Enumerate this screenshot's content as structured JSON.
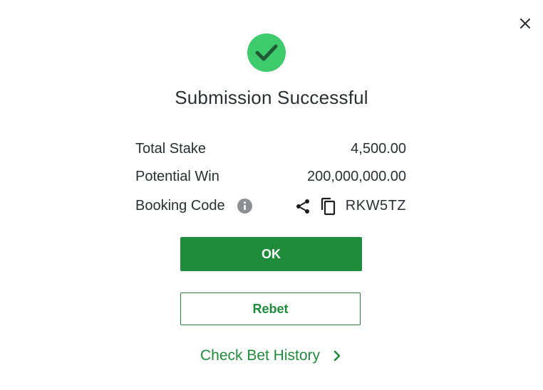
{
  "dialog": {
    "close_icon": "close-icon",
    "success_icon": "checkmark-icon",
    "title": "Submission Successful"
  },
  "summary": {
    "total_stake_label": "Total Stake",
    "total_stake_value": "4,500.00",
    "potential_win_label": "Potential Win",
    "potential_win_value": "200,000,000.00",
    "booking_code_label": "Booking Code",
    "booking_code_value": "RKW5TZ",
    "info_icon": "info-icon",
    "share_icon": "share-icon",
    "copy_icon": "copy-icon"
  },
  "actions": {
    "ok_label": "OK",
    "rebet_label": "Rebet",
    "history_label": "Check Bet History",
    "history_icon": "chevron-right-icon"
  },
  "colors": {
    "primary_green": "#1e8c3a",
    "success_circle": "#3dcb6c",
    "text": "#2b2e33",
    "muted_icon": "#8d8f94"
  }
}
